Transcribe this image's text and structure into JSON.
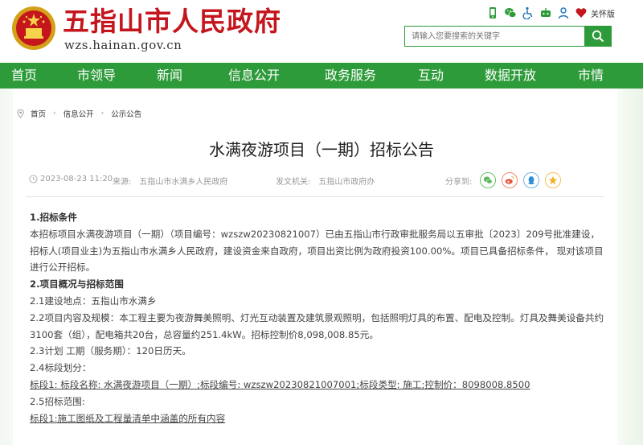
{
  "header": {
    "site_title": "五指山市人民政府",
    "site_domain": "wzs.hainan.gov.cn",
    "care_mode": "关怀版",
    "search_placeholder": "请输入您要搜索的关键字",
    "top_icons": [
      "mobile-icon",
      "wechat-icon",
      "accessibility-icon",
      "robot-icon",
      "user-icon",
      "care-icon"
    ]
  },
  "nav": {
    "items": [
      "首页",
      "市领导",
      "新闻",
      "信息公开",
      "政务服务",
      "互动",
      "数据开放",
      "市情"
    ]
  },
  "breadcrumb": {
    "home": "首页",
    "level1": "信息公开",
    "level2": "公示公告"
  },
  "article": {
    "title": "水满夜游项目（一期）招标公告",
    "date": "2023-08-23 11:20",
    "source_label": "来源:",
    "source": "五指山市水满乡人民政府",
    "publisher_label": "发文机关:",
    "publisher": "五指山市政府办",
    "share_label": "分享到:",
    "paragraphs": [
      {
        "type": "heading",
        "text": "1.招标条件"
      },
      {
        "type": "para",
        "text": "本招标项目水满夜游项目（一期）（项目编号：wzszw20230821007）已由五指山市行政审批服务局以五审批〔2023〕209号批准建设， 招标人(项目业主)为五指山市水满乡人民政府，建设资金来自政府，项目出资比例为政府投资100.00%。项目已具备招标条件， 现对该项目进行公开招标。"
      },
      {
        "type": "heading",
        "text": "2.项目概况与招标范围"
      },
      {
        "type": "line",
        "text": "2.1建设地点：五指山市水满乡"
      },
      {
        "type": "para",
        "text": "2.2项目内容及规模：本工程主要为夜游舞美照明、灯光互动装置及建筑景观照明，包括照明灯具的布置、配电及控制。灯具及舞美设备共约3100套（组），配电箱共20台，总容量约251.4kW。招标控制价8,098,008.85元。"
      },
      {
        "type": "line",
        "text": "2.3计划 工期（服务期）：120日历天。"
      },
      {
        "type": "line",
        "text": "2.4标段划分："
      },
      {
        "type": "underline",
        "text": "标段1: 标段名称: 水满夜游项目（一期）;标段编号: wzszw20230821007001;标段类型: 施工;控制价：8098008.8500"
      },
      {
        "type": "line",
        "text": "2.5招标范围:"
      },
      {
        "type": "underline",
        "text": "标段1:施工图纸及工程量清单中涵盖的所有内容"
      }
    ]
  },
  "colors": {
    "brand_green": "#2e9b3a",
    "title_red": "#c4161c"
  }
}
